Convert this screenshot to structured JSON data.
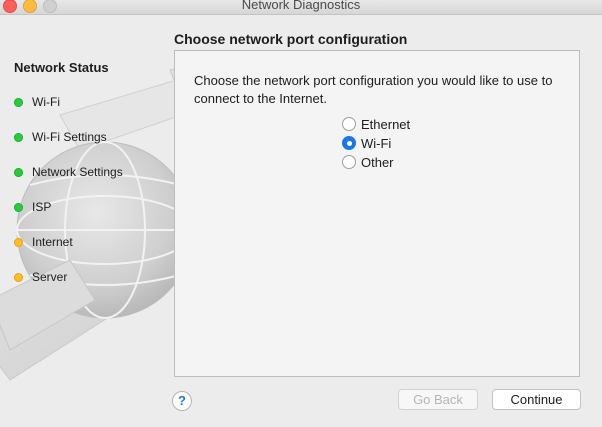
{
  "window": {
    "title": "Network Diagnostics"
  },
  "sidebar": {
    "title": "Network Status",
    "items": [
      {
        "label": "Wi-Fi",
        "status": "green"
      },
      {
        "label": "Wi-Fi Settings",
        "status": "green"
      },
      {
        "label": "Network Settings",
        "status": "green"
      },
      {
        "label": "ISP",
        "status": "green"
      },
      {
        "label": "Internet",
        "status": "yellow"
      },
      {
        "label": "Server",
        "status": "yellow"
      }
    ]
  },
  "main": {
    "section_title": "Choose network port configuration",
    "prompt": "Choose the network port configuration you would like to use to connect to the Internet.",
    "options": [
      {
        "label": "Ethernet",
        "selected": false
      },
      {
        "label": "Wi-Fi",
        "selected": true
      },
      {
        "label": "Other",
        "selected": false
      }
    ]
  },
  "footer": {
    "help_label": "?",
    "back_label": "Go Back",
    "continue_label": "Continue"
  },
  "colors": {
    "status_green": "#2ac940",
    "status_yellow": "#fdbc2c",
    "accent_blue": "#1b76e9"
  }
}
